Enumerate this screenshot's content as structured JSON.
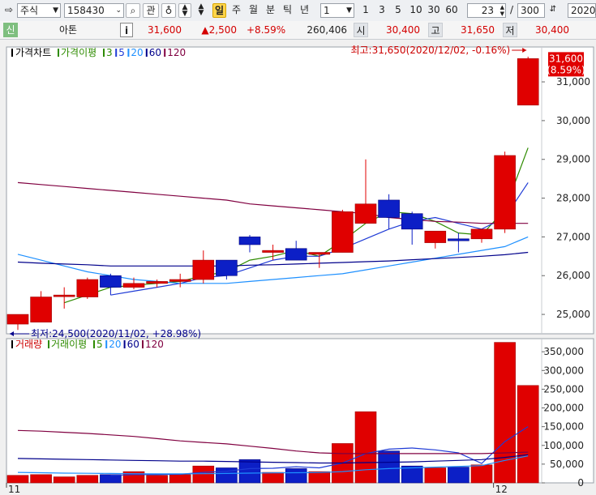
{
  "toolbar": {
    "market": "주식",
    "code": "158430",
    "btn_gwan": "관",
    "periods": [
      "일",
      "주",
      "월",
      "분",
      "틱",
      "년"
    ],
    "interval": "1",
    "quick": [
      "1",
      "3",
      "5",
      "10",
      "30",
      "60"
    ],
    "count_value": "23",
    "count_total": "300",
    "date": "2020/"
  },
  "info": {
    "badge": "신",
    "name": "아톤",
    "i_label": "i",
    "price": "31,600",
    "change": "▲2,500",
    "pct": "+8.59%",
    "volume": "260,406",
    "open_label": "시",
    "open": "30,400",
    "high_label": "고",
    "high": "31,650",
    "low_label": "저",
    "low": "30,400"
  },
  "legend_price": [
    {
      "text": "가격차트",
      "color": "#000000"
    },
    {
      "text": "가격이평",
      "color": "#2e8b00"
    },
    {
      "text": "3",
      "color": "#2e8b00"
    },
    {
      "text": "5",
      "color": "#1f3bd6"
    },
    {
      "text": "20",
      "color": "#1e90ff"
    },
    {
      "text": "60",
      "color": "#00008b"
    },
    {
      "text": "120",
      "color": "#800040"
    }
  ],
  "legend_volume": [
    {
      "text": "거래량",
      "color": "#cc0000"
    },
    {
      "text": "거래이평",
      "color": "#2e8b00"
    },
    {
      "text": "5",
      "color": "#2e8b00"
    },
    {
      "text": "20",
      "color": "#1e90ff"
    },
    {
      "text": "60",
      "color": "#00008b"
    },
    {
      "text": "120",
      "color": "#800040"
    }
  ],
  "colors": {
    "up": "#e00000",
    "down": "#0c1fc6",
    "ma3": "#2e8b00",
    "ma5": "#1f3bd6",
    "ma20": "#1e90ff",
    "ma60": "#00008b",
    "ma120": "#800040"
  },
  "chart_data": [
    {
      "type": "candlestick",
      "ylim": [
        24500,
        31900
      ],
      "y_ticks": [
        "25,000",
        "26,000",
        "27,000",
        "28,000",
        "29,000",
        "30,000",
        "31,000"
      ],
      "y_tick_values": [
        25000,
        26000,
        27000,
        28000,
        29000,
        30000,
        31000
      ],
      "x_labels": [
        {
          "index": 0,
          "text": "11"
        },
        {
          "index": 21,
          "text": "12"
        }
      ],
      "candles": [
        {
          "o": 24750,
          "h": 24900,
          "l": 24600,
          "c": 25000
        },
        {
          "o": 24800,
          "h": 25600,
          "l": 24800,
          "c": 25450
        },
        {
          "o": 25500,
          "h": 25700,
          "l": 25150,
          "c": 25500
        },
        {
          "o": 25450,
          "h": 25950,
          "l": 25400,
          "c": 25900
        },
        {
          "o": 26000,
          "h": 26050,
          "l": 25500,
          "c": 25700
        },
        {
          "o": 25700,
          "h": 25950,
          "l": 25650,
          "c": 25800
        },
        {
          "o": 25800,
          "h": 25900,
          "l": 25700,
          "c": 25850
        },
        {
          "o": 25850,
          "h": 26050,
          "l": 25700,
          "c": 25900
        },
        {
          "o": 25900,
          "h": 26650,
          "l": 25800,
          "c": 26400
        },
        {
          "o": 26400,
          "h": 26400,
          "l": 25900,
          "c": 26000
        },
        {
          "o": 27000,
          "h": 27050,
          "l": 26600,
          "c": 26800
        },
        {
          "o": 26600,
          "h": 26800,
          "l": 26400,
          "c": 26650
        },
        {
          "o": 26700,
          "h": 26900,
          "l": 26400,
          "c": 26400
        },
        {
          "o": 26550,
          "h": 26600,
          "l": 26200,
          "c": 26600
        },
        {
          "o": 26600,
          "h": 27700,
          "l": 26600,
          "c": 27650
        },
        {
          "o": 27350,
          "h": 29000,
          "l": 27350,
          "c": 27850
        },
        {
          "o": 27950,
          "h": 28100,
          "l": 27200,
          "c": 27500
        },
        {
          "o": 27600,
          "h": 27650,
          "l": 26800,
          "c": 27200
        },
        {
          "o": 26850,
          "h": 27150,
          "l": 26700,
          "c": 27150
        },
        {
          "o": 26950,
          "h": 27100,
          "l": 26600,
          "c": 26900
        },
        {
          "o": 26950,
          "h": 27200,
          "l": 26850,
          "c": 27200
        },
        {
          "o": 27200,
          "h": 29200,
          "l": 27100,
          "c": 29100
        },
        {
          "o": 30400,
          "h": 31650,
          "l": 30400,
          "c": 31600
        }
      ],
      "series": [
        {
          "name": "3",
          "values": [
            null,
            null,
            25300,
            25500,
            25700,
            25750,
            25800,
            25850,
            26000,
            26100,
            26400,
            26500,
            26650,
            26500,
            26900,
            27350,
            27650,
            27600,
            27400,
            27100,
            27050,
            27700,
            29300
          ]
        },
        {
          "name": "5",
          "values": [
            null,
            null,
            null,
            null,
            25500,
            25600,
            25700,
            25800,
            25950,
            26000,
            26200,
            26400,
            26500,
            26500,
            26700,
            26950,
            27200,
            27400,
            27500,
            27350,
            27200,
            27500,
            28400
          ]
        },
        {
          "name": "20",
          "values": [
            26550,
            26400,
            26250,
            26100,
            26000,
            25900,
            25850,
            25800,
            25800,
            25800,
            25850,
            25900,
            25950,
            26000,
            26050,
            26150,
            26250,
            26350,
            26450,
            26550,
            26650,
            26750,
            27000
          ]
        },
        {
          "name": "60",
          "values": [
            26350,
            26320,
            26300,
            26280,
            26250,
            26250,
            26250,
            26250,
            26250,
            26250,
            26270,
            26280,
            26300,
            26320,
            26340,
            26360,
            26380,
            26410,
            26440,
            26470,
            26500,
            26540,
            26600
          ]
        },
        {
          "name": "120",
          "values": [
            28400,
            28350,
            28300,
            28250,
            28200,
            28150,
            28100,
            28050,
            28000,
            27950,
            27850,
            27800,
            27750,
            27700,
            27650,
            27600,
            27500,
            27450,
            27400,
            27380,
            27350,
            27350,
            27350
          ]
        }
      ],
      "annotations": [
        {
          "text": "최고:31,650(2020/12/02, -0.16%)",
          "color": "#cc0000"
        },
        {
          "text": "최저:24,500(2020/11/02, +28.98%)",
          "color": "#00008b"
        }
      ],
      "last_price_label": "31,600",
      "last_pct_label": "(8.59%)"
    },
    {
      "type": "bar",
      "ylim": [
        0,
        385000
      ],
      "y_ticks": [
        "0",
        "50,000",
        "100,000",
        "150,000",
        "200,000",
        "250,000",
        "300,000",
        "350,000"
      ],
      "y_tick_values": [
        0,
        50000,
        100000,
        150000,
        200000,
        250000,
        300000,
        350000
      ],
      "values": [
        20000,
        22000,
        16000,
        20000,
        22000,
        30000,
        20000,
        22000,
        45000,
        40000,
        62000,
        28000,
        38000,
        30000,
        105000,
        190000,
        85000,
        45000,
        40000,
        42000,
        48000,
        375000,
        260000
      ],
      "series": [
        {
          "name": "5",
          "values": [
            null,
            null,
            null,
            null,
            20000,
            22000,
            22000,
            23000,
            28000,
            31000,
            38000,
            39000,
            43000,
            40000,
            53000,
            78000,
            90000,
            93000,
            88000,
            80000,
            52000,
            110000,
            150000
          ]
        },
        {
          "name": "20",
          "values": [
            28000,
            27000,
            26000,
            25500,
            25000,
            24500,
            24000,
            24000,
            24500,
            25000,
            26000,
            26500,
            27000,
            27500,
            30000,
            35000,
            38000,
            40000,
            42000,
            44000,
            46000,
            60000,
            72000
          ]
        },
        {
          "name": "60",
          "values": [
            65000,
            64000,
            63000,
            62000,
            61000,
            60000,
            59000,
            58000,
            58000,
            57000,
            56000,
            55000,
            54000,
            53000,
            53000,
            54000,
            55000,
            56000,
            58000,
            60000,
            62000,
            68000,
            75000
          ]
        },
        {
          "name": "120",
          "values": [
            140000,
            138000,
            135000,
            132000,
            128000,
            124000,
            118000,
            112000,
            108000,
            104000,
            98000,
            92000,
            85000,
            80000,
            78000,
            78000,
            78000,
            78000,
            78000,
            78000,
            78000,
            80000,
            82000
          ]
        }
      ]
    }
  ]
}
